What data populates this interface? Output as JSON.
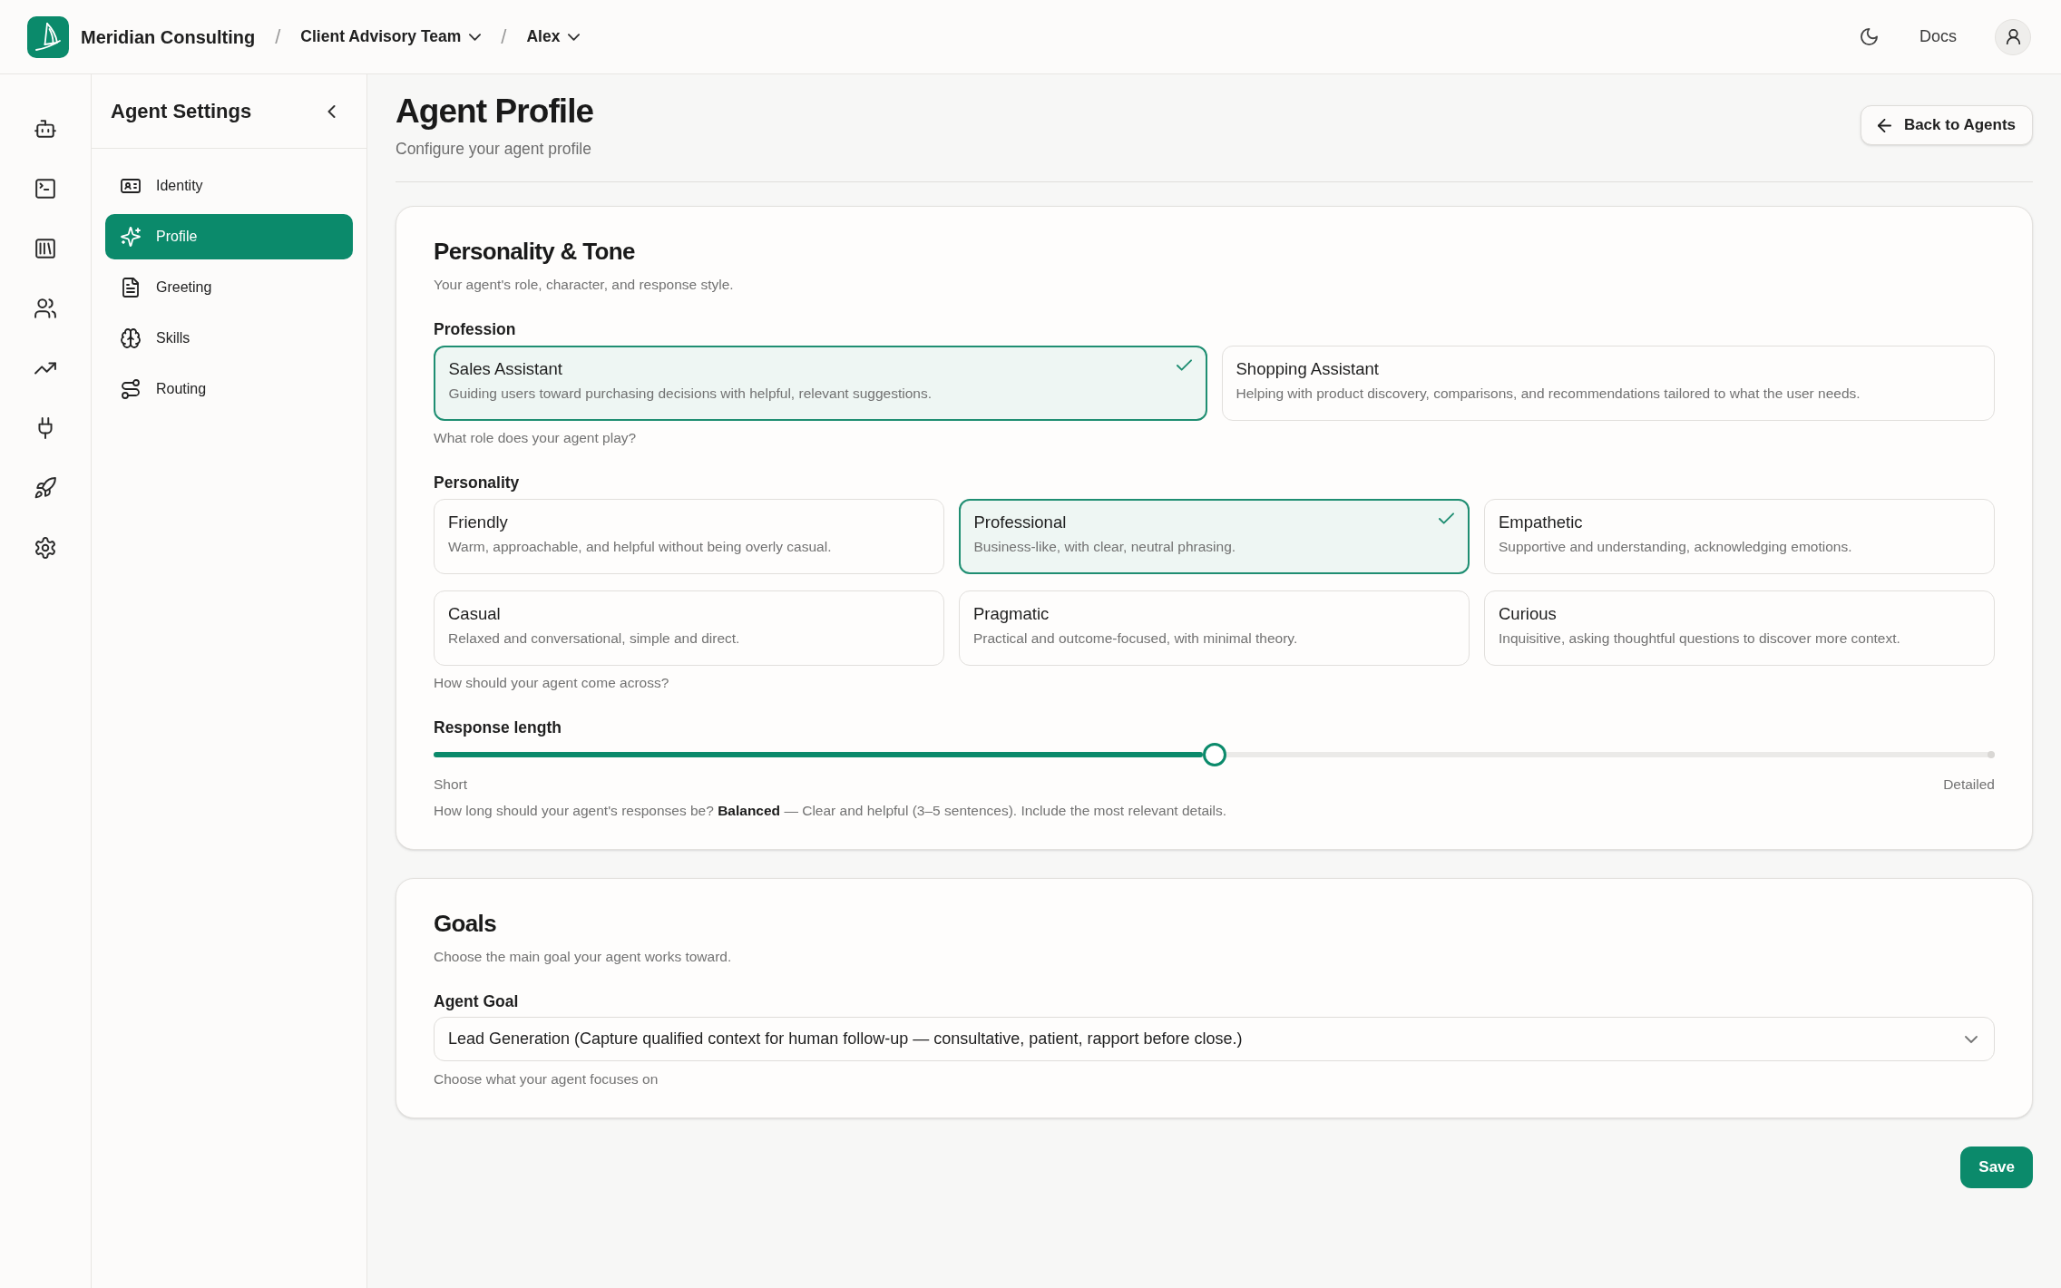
{
  "top_bar": {
    "brand": "Meridian Consulting",
    "breadcrumbs": [
      {
        "separator": "/",
        "label": "Client Advisory Team"
      },
      {
        "separator": "/",
        "label": "Alex"
      }
    ],
    "docs_link": "Docs"
  },
  "sidebar": {
    "title": "Agent Settings",
    "items": [
      {
        "label": "Identity",
        "selected": false
      },
      {
        "label": "Profile",
        "selected": true
      },
      {
        "label": "Greeting",
        "selected": false
      },
      {
        "label": "Skills",
        "selected": false
      },
      {
        "label": "Routing",
        "selected": false
      }
    ]
  },
  "page": {
    "title": "Agent Profile",
    "subtitle": "Configure your agent profile",
    "back_button": "Back to Agents"
  },
  "sections": [
    {
      "title": "Personality & Tone",
      "subtitle": "Your agent's role, character, and response style.",
      "fields": [
        {
          "kind": "choice",
          "label": "Profession",
          "options": [
            {
              "title": "Sales Assistant",
              "description": "Guiding users toward purchasing decisions with helpful, relevant suggestions.",
              "selected": true
            },
            {
              "title": "Shopping Assistant",
              "description": "Helping with product discovery, comparisons, and recommendations tailored to what the user needs.",
              "selected": false
            }
          ],
          "hint": "What role does your agent play?"
        },
        {
          "kind": "choice",
          "label": "Personality",
          "options": [
            {
              "title": "Friendly",
              "description": "Warm, approachable, and helpful without being overly casual.",
              "selected": false
            },
            {
              "title": "Professional",
              "description": "Business-like, with clear, neutral phrasing.",
              "selected": true
            },
            {
              "title": "Empathetic",
              "description": "Supportive and understanding, acknowledging emotions.",
              "selected": false
            },
            {
              "title": "Casual",
              "description": "Relaxed and conversational, simple and direct.",
              "selected": false
            },
            {
              "title": "Pragmatic",
              "description": "Practical and outcome-focused, with minimal theory.",
              "selected": false
            },
            {
              "title": "Curious",
              "description": "Inquisitive, asking thoughtful questions to discover more context.",
              "selected": false
            }
          ],
          "hint": "How should your agent come across?"
        },
        {
          "kind": "slider",
          "label": "Response length",
          "level": 0.5,
          "min_label": "Short",
          "max_label": "Detailed",
          "hint": "How long should your agent's responses be? **Balanced** — Clear and helpful (3–5 sentences). Include the most relevant details."
        }
      ]
    },
    {
      "title": "Goals",
      "subtitle": "Choose the main goal your agent works toward.",
      "fields": [
        {
          "kind": "select",
          "label": "Agent Goal",
          "value": "Lead Generation (Capture qualified context for human follow-up — consultative, patient, rapport before close.)",
          "hint": "Choose what your agent focuses on"
        }
      ]
    }
  ],
  "save_button": "Save"
}
